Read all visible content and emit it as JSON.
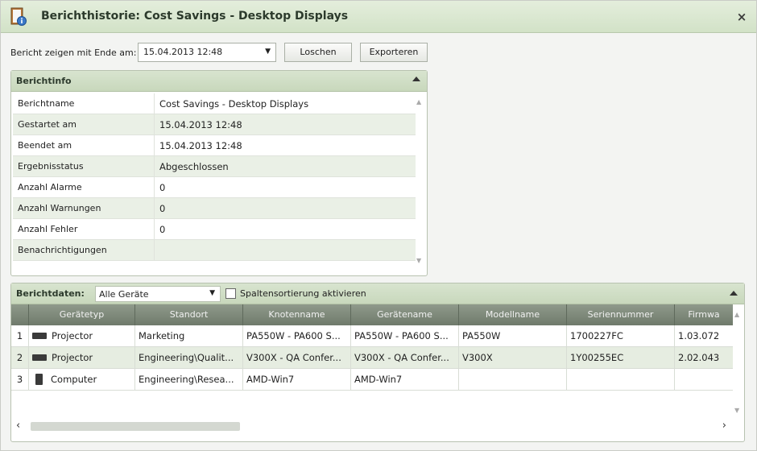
{
  "window": {
    "title": "Berichthistorie: Cost Savings - Desktop Displays",
    "close_label": "×"
  },
  "toolbar": {
    "date_label": "Bericht zeigen mit Ende am:",
    "date_value": "15.04.2013 12:48",
    "delete_label": "Loschen",
    "export_label": "Exporteren"
  },
  "info": {
    "header": "Berichtinfo",
    "rows": [
      {
        "key": "Berichtname",
        "value": "Cost Savings - Desktop Displays"
      },
      {
        "key": "Gestartet am",
        "value": "15.04.2013 12:48"
      },
      {
        "key": "Beendet am",
        "value": "15.04.2013 12:48"
      },
      {
        "key": "Ergebnisstatus",
        "value": "Abgeschlossen"
      },
      {
        "key": "Anzahl Alarme",
        "value": "0"
      },
      {
        "key": "Anzahl Warnungen",
        "value": "0"
      },
      {
        "key": "Anzahl Fehler",
        "value": "0"
      },
      {
        "key": "Benachrichtigungen",
        "value": ""
      }
    ]
  },
  "data": {
    "header": "Berichtdaten:",
    "filter_value": "Alle Geräte",
    "sort_label": "Spaltensortierung aktivieren",
    "columns": [
      "Gerätetyp",
      "Standort",
      "Knotenname",
      "Gerätename",
      "Modellname",
      "Seriennummer",
      "Firmwa"
    ],
    "rows": [
      {
        "num": "1",
        "icon": "projector-icon",
        "type": "Projector",
        "location": "Marketing",
        "node": "PA550W - PA600 S...",
        "device": "PA550W - PA600 S...",
        "model": "PA550W",
        "serial": "1700227FC",
        "firmware": "1.03.072"
      },
      {
        "num": "2",
        "icon": "projector-icon",
        "type": "Projector",
        "location": "Engineering\\Qualit...",
        "node": "V300X - QA Confer...",
        "device": "V300X - QA Confer...",
        "model": "V300X",
        "serial": "1Y00255EC",
        "firmware": "2.02.043"
      },
      {
        "num": "3",
        "icon": "computer-icon",
        "type": "Computer",
        "location": "Engineering\\Resea...",
        "node": "AMD-Win7",
        "device": "AMD-Win7",
        "model": "",
        "serial": "",
        "firmware": ""
      }
    ]
  },
  "colors": {
    "header_green": "#c8d8bc",
    "grid_header": "#7a8576",
    "alt_row": "#e6ede1"
  }
}
